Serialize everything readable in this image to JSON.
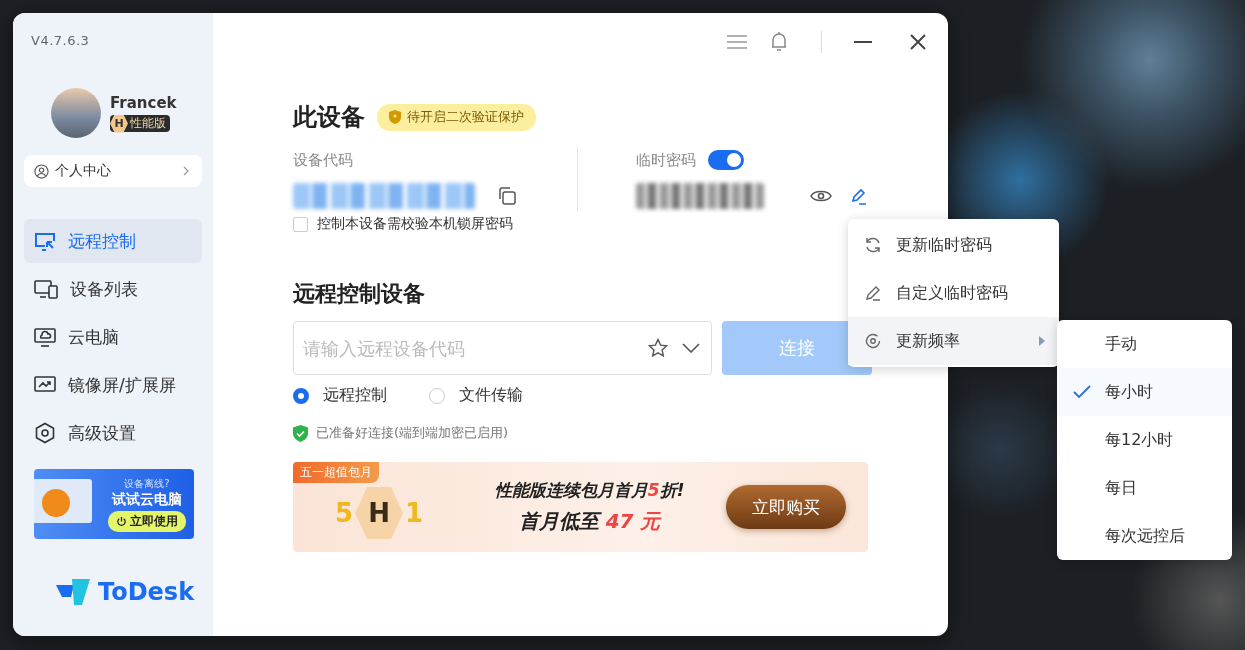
{
  "window": {
    "version": "V4.7.6.3"
  },
  "user": {
    "name": "Francek",
    "badge_letter": "H",
    "badge": "性能版"
  },
  "personal_center": "个人中心",
  "nav": [
    {
      "kind": "remote",
      "label": "远程控制",
      "selected": true
    },
    {
      "kind": "devices",
      "label": "设备列表",
      "selected": false
    },
    {
      "kind": "cloud",
      "label": "云电脑",
      "selected": false
    },
    {
      "kind": "mirror",
      "label": "镜像屏/扩展屏",
      "selected": false
    },
    {
      "kind": "settings",
      "label": "高级设置",
      "selected": false
    }
  ],
  "cloud_ad": {
    "question": "设备离线?",
    "title": "试试云电脑",
    "button": "立即使用"
  },
  "logo": "ToDesk",
  "this_device": {
    "title": "此设备",
    "badge": "待开启二次验证保护",
    "code_label": "设备代码",
    "password_label": "临时密码",
    "password_enabled": true,
    "lock_check": {
      "label": "控制本设备需校验本机锁屏密码",
      "checked": false
    }
  },
  "remote": {
    "title": "远程控制设备",
    "placeholder": "请输入远程设备代码",
    "connect": "连接",
    "connect_disabled": true,
    "modes": [
      {
        "label": "远程控制",
        "selected": true
      },
      {
        "label": "文件传输",
        "selected": false
      }
    ],
    "status": "已准备好连接(端到端加密已启用)"
  },
  "promo": {
    "tag": "五一超值包月",
    "glyphs": [
      "5",
      "H",
      "1"
    ],
    "headline": {
      "before": "性能版连续包月首月",
      "highlight": "5",
      "after": "折!"
    },
    "price": {
      "before": "首月低至",
      "amount": "47",
      "unit": "元"
    },
    "button": "立即购买"
  },
  "menu": [
    {
      "kind": "refresh",
      "label": "更新临时密码",
      "submenu": false,
      "selected": false
    },
    {
      "kind": "edit",
      "label": "自定义临时密码",
      "submenu": false,
      "selected": false
    },
    {
      "kind": "frequency",
      "label": "更新频率",
      "submenu": true,
      "selected": true
    }
  ],
  "submenu": [
    {
      "label": "手动",
      "selected": false
    },
    {
      "label": "每小时",
      "selected": true
    },
    {
      "label": "每12小时",
      "selected": false
    },
    {
      "label": "每日",
      "selected": false
    },
    {
      "label": "每次远控后",
      "selected": false
    }
  ]
}
